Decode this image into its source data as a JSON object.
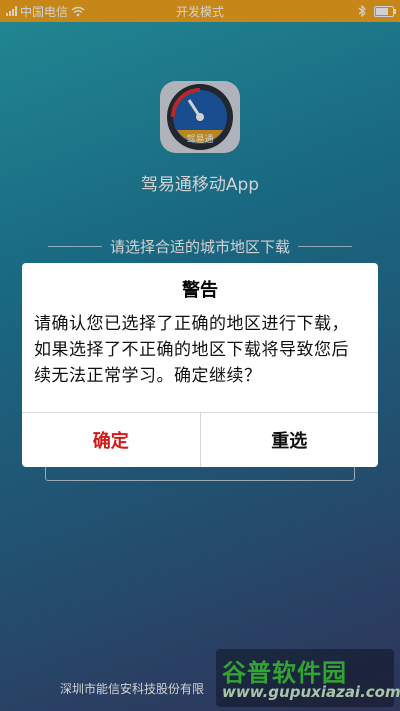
{
  "status_bar": {
    "carrier": "中国电信",
    "mode": "开发模式",
    "icons": [
      "signal-icon",
      "wifi-icon",
      "bluetooth-icon",
      "battery-icon"
    ]
  },
  "app": {
    "logo_label": "驾易通",
    "title": "驾易通移动App",
    "region_prompt": "请选择合适的城市地区下载"
  },
  "dialog": {
    "title": "警告",
    "message": "请确认您已选择了正确的地区进行下载，如果选择了不正确的地区下载将导致您后续无法正常学习。确定继续？",
    "confirm_label": "确定",
    "reselect_label": "重选"
  },
  "footer": {
    "company": "深圳市能信安科技股份有限"
  },
  "watermark": {
    "name": "谷普软件园",
    "url": "www.gupuxiazai.com"
  },
  "colors": {
    "status_bar": "#f2a51e",
    "confirm_text": "#d11a1a",
    "logo_gold": "#e5a521"
  }
}
